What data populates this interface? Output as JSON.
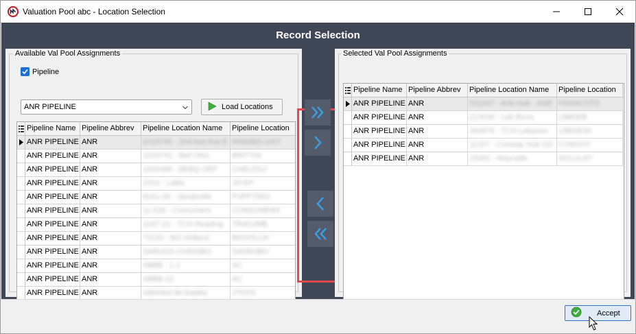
{
  "window": {
    "title": "Valuation Pool abc - Location Selection",
    "header": "Record Selection"
  },
  "left": {
    "group_label": "Available Val Pool Assignments",
    "filter": {
      "checkbox_label": "Pipeline",
      "checked": true,
      "selected_value": "ANR PIPELINE"
    },
    "load_button_label": "Load Locations",
    "columns": [
      "Pipeline Name",
      "Pipeline Abbrev",
      "Pipeline Location Name",
      "Pipeline Location"
    ],
    "rows": [
      {
        "name": "ANR PIPELINE",
        "abbrev": "ANR",
        "loc_name": "1019745 - 2nd Ave Ave E",
        "loc": "WMMBS-1007"
      },
      {
        "name": "ANR PIPELINE",
        "abbrev": "ANR",
        "loc_name": "1019741 - Bell Ohio",
        "loc": "BRIT704"
      },
      {
        "name": "ANR PIPELINE",
        "abbrev": "ANR",
        "loc_name": "1045488 - BEBQ OEF",
        "loc": "CHELEGJ"
      },
      {
        "name": "ANR PIPELINE",
        "abbrev": "ANR",
        "loc_name": "2419 - Labia",
        "loc": "JH-EP"
      },
      {
        "name": "ANR PIPELINE",
        "abbrev": "ANR",
        "loc_name": "8241-26 - Vandeville",
        "loc": "PVPPTRIO"
      },
      {
        "name": "ANR PIPELINE",
        "abbrev": "ANR",
        "loc_name": "11-026 - Consumers",
        "loc": "CONSUMER5"
      },
      {
        "name": "ANR PIPELINE",
        "abbrev": "ANR",
        "loc_name": "1047-10 - TCO Reading",
        "loc": "TRADJMB"
      },
      {
        "name": "ANR PIPELINE",
        "abbrev": "ANR",
        "loc_name": "70220 - BG Holland",
        "loc": "BGHOLLM"
      },
      {
        "name": "ANR PIPELINE",
        "abbrev": "ANR",
        "loc_name": "SARUOS-CHRISBO",
        "loc": "SADEHBO"
      },
      {
        "name": "ANR PIPELINE",
        "abbrev": "ANR",
        "loc_name": "ABBB - 1 2",
        "loc": "AC"
      },
      {
        "name": "ANR PIPELINE",
        "abbrev": "ANR",
        "loc_name": "ABBB-10",
        "loc": "AC"
      },
      {
        "name": "ANR PIPELINE",
        "abbrev": "ANR",
        "loc_name": "sddodsd-de-loadea",
        "loc": "JTKDS"
      },
      {
        "name": "ANR PIPELINE",
        "abbrev": "ANR",
        "loc_name": "fibch",
        "loc": "vb"
      }
    ]
  },
  "right": {
    "group_label": "Selected Val Pool Assignments",
    "columns": [
      "Pipeline Name",
      "Pipeline Abbrev",
      "Pipeline Location Name",
      "Pipeline Location"
    ],
    "rows": [
      {
        "name": "ANR PIPELINE",
        "abbrev": "ANR",
        "loc_name": "201947 - Anb Hub - ANR",
        "loc": "FRANCSTD"
      },
      {
        "name": "ANR PIPELINE",
        "abbrev": "ANR",
        "loc_name": "213049 - Leb Bona",
        "loc": "LBB0EB"
      },
      {
        "name": "ANR PIPELINE",
        "abbrev": "ANR",
        "loc_name": "344876 - TCO Lebanon",
        "loc": "LBBSE50"
      },
      {
        "name": "ANR PIPELINE",
        "abbrev": "ANR",
        "loc_name": "11207 - Conway Hub GD",
        "loc": "CONSOT"
      },
      {
        "name": "ANR PIPELINE",
        "abbrev": "ANR",
        "loc_name": "23081 - Maynalle",
        "loc": "SOLUL6Y"
      }
    ]
  },
  "mover": {
    "buttons": [
      "move-all-right",
      "move-right",
      "move-left",
      "move-all-left"
    ],
    "accent": "#3aa0e8",
    "highlight": "#e5484d"
  },
  "footer": {
    "accept_label": "Accept"
  }
}
